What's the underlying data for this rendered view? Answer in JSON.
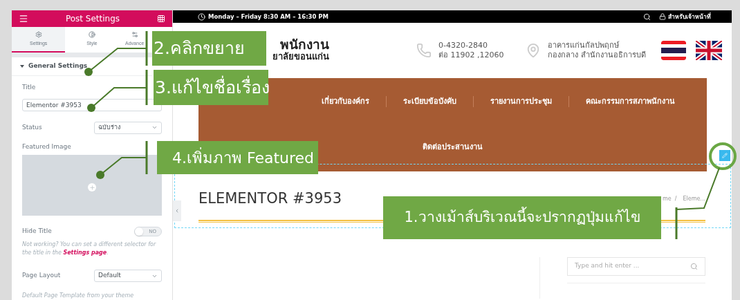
{
  "editor_panel": {
    "title": "Post Settings",
    "tabs": [
      {
        "kind": "settings",
        "label": "Settings",
        "selected": true
      },
      {
        "kind": "style",
        "label": "Style",
        "selected": false
      },
      {
        "kind": "advanced",
        "label": "Advance",
        "selected": false
      }
    ],
    "section": {
      "title": "General Settings",
      "expanded": true
    },
    "fields": [
      {
        "kind": "text",
        "label": "Title",
        "value": "Elementor #3953"
      },
      {
        "kind": "select",
        "label": "Status",
        "value": "ฉบับร่าง"
      },
      {
        "kind": "image",
        "label": "Featured Image"
      },
      {
        "kind": "toggle",
        "label": "Hide Title",
        "on": false,
        "state_label": "NO"
      },
      {
        "kind": "note",
        "text": "Not working? You can set a different selector for the title in the ",
        "link": "Settings page",
        "after": "."
      },
      {
        "kind": "select",
        "label": "Page Layout",
        "value": "Default"
      },
      {
        "kind": "hint",
        "text": "Default Page Template from your theme"
      }
    ]
  },
  "site": {
    "top_bar": {
      "hours": "Monday – Friday 8:30 AM – 16:30 PM",
      "staff_link": "สำหรับเจ้าหน้าที่"
    },
    "logo": {
      "line_1": "พนักงาน",
      "line_2": "ยาลัยขอนแก่น"
    },
    "phone": [
      "0-4320-2840",
      "ต่อ 11902 ,12060"
    ],
    "address": [
      "อาคารแก่นกัลปพฤกษ์",
      "กองกลาง สำนักงานอธิการบดี"
    ],
    "flags": [
      {
        "kind": "thai"
      },
      {
        "kind": "uk"
      }
    ],
    "nav": [
      [
        "เกี่ยวกับองค์กร",
        "ระเบียบข้อบังคับ",
        "รายงานการประชุม",
        "คณะกรรมการสภาพนักงาน"
      ],
      [
        "ติดต่อประสานงาน"
      ]
    ],
    "page_title": "ELEMENTOR #3953",
    "breadcrumb": {
      "items": [
        "me",
        "Eleme..."
      ],
      "separator": "/"
    },
    "search": {
      "placeholder": "Type and hit enter ..."
    }
  },
  "callouts": [
    {
      "text": "1.วางเม้าส์บริเวณนี้จะปรากฏปุ่มแก้ไข"
    },
    {
      "text": "2.คลิกขยาย"
    },
    {
      "text": "3.แก้ไขชื่อเรื่อง"
    },
    {
      "text": "4.เพิ่มภาพ Featured"
    }
  ]
}
